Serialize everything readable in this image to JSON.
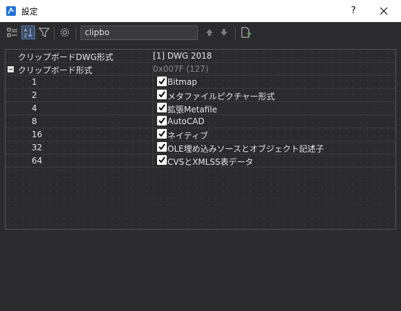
{
  "window": {
    "title": "設定",
    "help_label": "?",
    "accent": "#1e6fd9"
  },
  "toolbar": {
    "search_value": "clipbo",
    "icons": [
      "categorized-icon",
      "alphabetical-icon",
      "filter-icon",
      "settings-icon",
      "move-up-icon",
      "move-down-icon",
      "export-icon"
    ]
  },
  "properties": [
    {
      "name": "クリップボードDWG形式",
      "value": "[1] DWG 2018"
    },
    {
      "name": "クリップボード形式",
      "value": "0x007F (127)",
      "expanded": true,
      "children": [
        {
          "name": "1",
          "label": "Bitmap",
          "checked": true
        },
        {
          "name": "2",
          "label": "メタファイルピクチャー形式",
          "checked": true
        },
        {
          "name": "4",
          "label": "拡張Metafile",
          "checked": true
        },
        {
          "name": "8",
          "label": "AutoCAD",
          "checked": true
        },
        {
          "name": "16",
          "label": "ネイティブ",
          "checked": true
        },
        {
          "name": "32",
          "label": "OLE埋め込みソースとオブジェクト記述子",
          "checked": true
        },
        {
          "name": "64",
          "label": "CVSとXMLSS表データ",
          "checked": true
        }
      ]
    }
  ]
}
